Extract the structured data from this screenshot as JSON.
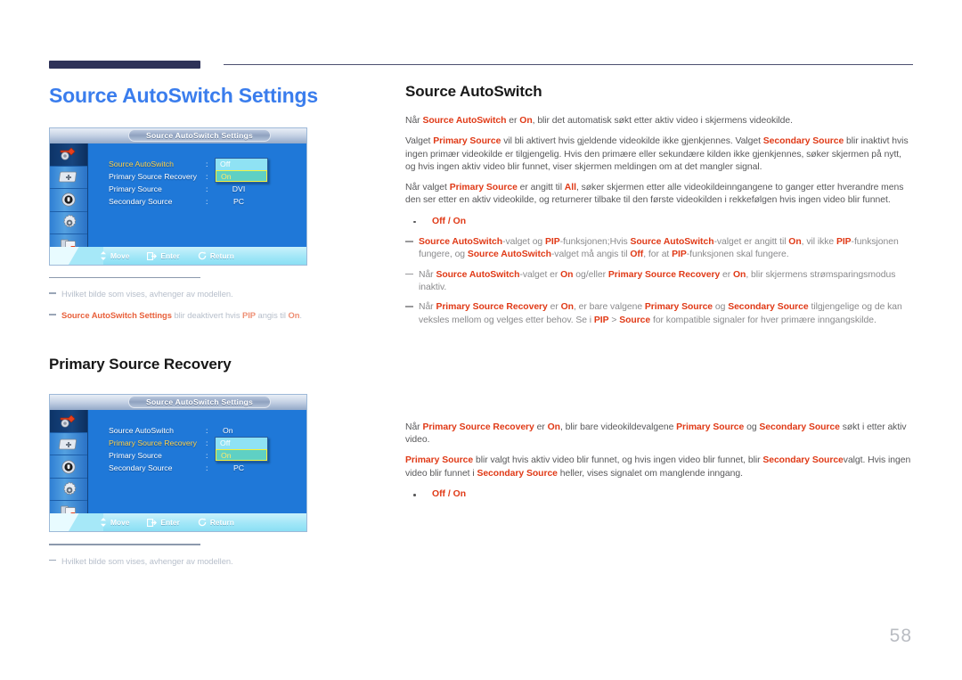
{
  "page": {
    "number": "58",
    "accent_blue": "#3a7ded",
    "accent_red": "#e03a17",
    "rule_navy": "#2e3258"
  },
  "left": {
    "section_title": "Source AutoSwitch Settings",
    "sub_title": "Primary Source Recovery",
    "notes_1": [
      {
        "prefix": "",
        "bold": "",
        "text": "Hvilket bilde som vises, avhenger av modellen."
      },
      {
        "prefix": "",
        "bold": "Source AutoSwitch Settings",
        "text": " blir deaktivert hvis ",
        "bold2": "PIP",
        "text2": " angis til ",
        "bold3": "On",
        "text3": "."
      }
    ],
    "notes_2": [
      {
        "text": "Hvilket bilde som vises, avhenger av modellen."
      }
    ]
  },
  "right": {
    "heading_1": "Source AutoSwitch",
    "heading_2": "Primary Source Recovery",
    "paragraphs_1": [
      "Når Source AutoSwitch er On, blir det automatisk søkt etter aktiv video i skjermens videokilde.",
      "Valget Primary Source vil bli aktivert hvis gjeldende videokilde ikke gjenkjennes. Valget Secondary Source blir inaktivt hvis ingen primær videokilde er tilgjengelig. Hvis den primære eller sekundære kilden ikke gjenkjennes, søker skjermen på nytt, og hvis ingen aktiv video blir funnet, viser skjermen meldingen om at det mangler signal.",
      "Når valget Primary Source er angitt til All, søker skjermen etter alle videokildeinngangene to ganger etter hverandre mens den ser etter en aktiv videokilde, og returnerer tilbake til den første videokilden i rekkefølgen hvis ingen video blir funnet."
    ],
    "bullet_1": "Off / On",
    "dash_notes_1": [
      "Source AutoSwitch-valget og PIP-funksjonen;Hvis Source AutoSwitch-valget er angitt til On, vil ikke PIP-funksjonen fungere, og Source AutoSwitch-valget må angis til Off, for at PIP-funksjonen skal fungere.",
      "Når Source AutoSwitch-valget er On og/eller Primary Source Recovery er On, blir skjermens strømsparingsmodus inaktiv.",
      "Når Primary Source Recovery er On, er bare valgene Primary Source og Secondary Source tilgjengelige og de kan veksles mellom og velges etter behov. Se i PIP > Source for kompatible signaler for hver primære inngangskilde."
    ],
    "paragraphs_2": [
      "Når Primary Source Recovery er On, blir bare videokildevalgene Primary Source og Secondary Source søkt i etter aktiv video.",
      "Primary Source blir valgt hvis aktiv video blir funnet, og hvis ingen video blir funnet, blir Secondary Sourcevalgt. Hvis ingen video blir funnet i Secondary Source heller, vises signalet om manglende inngang."
    ],
    "bullet_2": "Off / On"
  },
  "osd1": {
    "title": "Source AutoSwitch Settings",
    "rows": [
      {
        "label": "Source AutoSwitch",
        "colon": ":",
        "value": "",
        "highlighted": true
      },
      {
        "label": "Primary Source Recovery",
        "colon": ":",
        "value": "",
        "highlighted": false
      },
      {
        "label": "Primary Source",
        "colon": ":",
        "value": "DVI",
        "highlighted": false
      },
      {
        "label": "Secondary Source",
        "colon": ":",
        "value": "PC",
        "highlighted": false
      }
    ],
    "dropdown": {
      "option_off": "Off",
      "option_on": "On",
      "selected": "On"
    },
    "footer": {
      "move": "Move",
      "enter": "Enter",
      "return": "Return"
    },
    "side_icons": [
      "input-source-icon",
      "picture-icon",
      "sound-icon",
      "setup-gear-icon",
      "multi-control-icon"
    ]
  },
  "osd2": {
    "title": "Source AutoSwitch Settings",
    "rows": [
      {
        "label": "Source AutoSwitch",
        "colon": ":",
        "value": "On",
        "highlighted": false
      },
      {
        "label": "Primary Source Recovery",
        "colon": ":",
        "value": "",
        "highlighted": true
      },
      {
        "label": "Primary Source",
        "colon": ":",
        "value": "",
        "highlighted": false
      },
      {
        "label": "Secondary Source",
        "colon": ":",
        "value": "PC",
        "highlighted": false
      }
    ],
    "dropdown": {
      "option_off": "Off",
      "option_on": "On",
      "selected": "On"
    },
    "footer": {
      "move": "Move",
      "enter": "Enter",
      "return": "Return"
    },
    "side_icons": [
      "input-source-icon",
      "picture-icon",
      "sound-icon",
      "setup-gear-icon",
      "multi-control-icon"
    ]
  }
}
